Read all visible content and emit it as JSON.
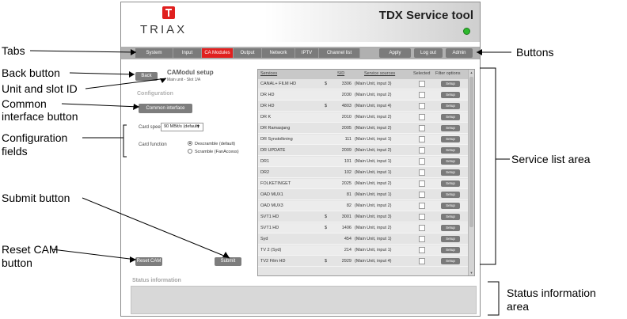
{
  "annotations": {
    "tabs": "Tabs",
    "back_button": "Back button",
    "unit_slot_id": "Unit and slot ID",
    "common_interface_1": "Common",
    "common_interface_2": "interface button",
    "config_fields_1": "Configuration",
    "config_fields_2": "fields",
    "submit_button": "Submit button",
    "reset_cam_1": "Reset CAM",
    "reset_cam_2": "button",
    "buttons": "Buttons",
    "service_list_area": "Service list area",
    "status_info_1": "Status information",
    "status_info_2": "area"
  },
  "header": {
    "logo_text": "TRIAX",
    "app_title": "TDX Service tool",
    "status_led_color": "#2db92d"
  },
  "tabs": [
    "System",
    "Input",
    "CA Modules",
    "Output",
    "Network",
    "IPTV",
    "Channel list"
  ],
  "active_tab": "CA Modules",
  "top_buttons": [
    "Apply",
    "Log out",
    "Admin"
  ],
  "camodule": {
    "back_label": "Back",
    "title": "CAModul setup",
    "unit_slot": "Main unit - Slot 1/A",
    "config_heading": "Configuration",
    "common_interface_label": "Common interface",
    "card_speed_label": "Card speed",
    "card_speed_value": "90 MBit/s (default)",
    "card_function_label": "Card function",
    "card_function_options": [
      "Descramble (default)",
      "Scramble (FanAccess)"
    ],
    "reset_cam_label": "Reset CAM",
    "submit_label": "Submit"
  },
  "service_list": {
    "headers": {
      "services": "Services",
      "sid": "SID",
      "source": "Service sources",
      "selected": "Selected",
      "filter": "Filter options"
    },
    "setup_label": "Setup",
    "rows": [
      {
        "name": "CANAL+ FILM HD",
        "scr": "$",
        "sid": "3306",
        "source": "(Main Unit, input 3)"
      },
      {
        "name": "DR HD",
        "scr": "",
        "sid": "2030",
        "source": "(Main Unit, input 2)"
      },
      {
        "name": "DR HD",
        "scr": "$",
        "sid": "4803",
        "source": "(Main Unit, input 4)"
      },
      {
        "name": "DR K",
        "scr": "",
        "sid": "2010",
        "source": "(Main Unit, input 2)"
      },
      {
        "name": "DR Ramasjang",
        "scr": "",
        "sid": "2005",
        "source": "(Main Unit, input 2)"
      },
      {
        "name": "DR Synstolkning",
        "scr": "",
        "sid": "111",
        "source": "(Main Unit, input 1)"
      },
      {
        "name": "DR UPDATE",
        "scr": "",
        "sid": "2009",
        "source": "(Main Unit, input 2)"
      },
      {
        "name": "DR1",
        "scr": "",
        "sid": "101",
        "source": "(Main Unit, input 1)"
      },
      {
        "name": "DR2",
        "scr": "",
        "sid": "102",
        "source": "(Main Unit, input 1)"
      },
      {
        "name": "FOLKETINGET",
        "scr": "",
        "sid": "2025",
        "source": "(Main Unit, input 2)"
      },
      {
        "name": "OAD MUX1",
        "scr": "",
        "sid": "81",
        "source": "(Main Unit, input 1)"
      },
      {
        "name": "OAD MUX3",
        "scr": "",
        "sid": "82",
        "source": "(Main Unit, input 2)"
      },
      {
        "name": "SVT1 HD",
        "scr": "$",
        "sid": "3001",
        "source": "(Main Unit, input 3)"
      },
      {
        "name": "SVT1 HD",
        "scr": "$",
        "sid": "1406",
        "source": "(Main Unit, input 2)"
      },
      {
        "name": "Syd",
        "scr": "",
        "sid": "454",
        "source": "(Main Unit, input 1)"
      },
      {
        "name": "TV 2 (Syd)",
        "scr": "",
        "sid": "214",
        "source": "(Main Unit, input 1)"
      },
      {
        "name": "TV2 Film HD",
        "scr": "$",
        "sid": "2929",
        "source": "(Main Unit, input 4)"
      }
    ]
  },
  "status": {
    "title": "Status information"
  }
}
